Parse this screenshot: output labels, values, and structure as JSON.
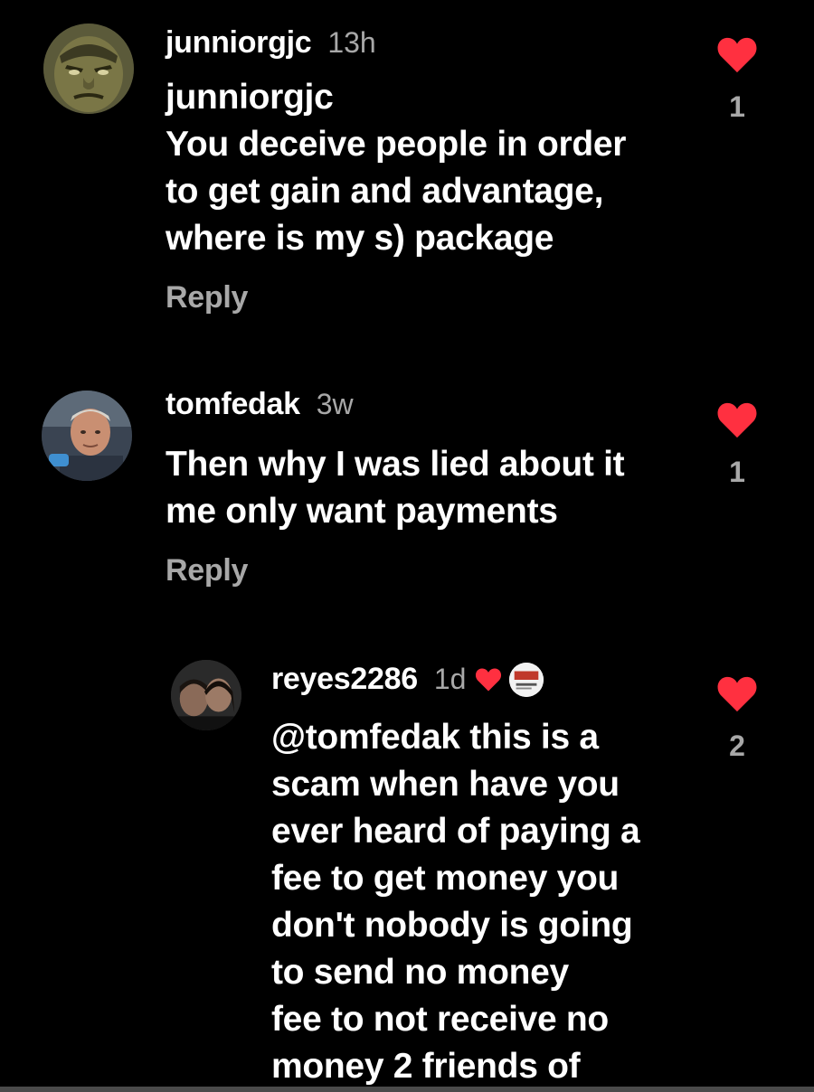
{
  "comments": [
    {
      "username": "junniorgjc",
      "time": "13h",
      "lines": [
        "junniorgjc",
        "You deceive people in order",
        "to get gain and advantage,",
        "where is my s) package"
      ],
      "reply_label": "Reply",
      "likes": "1",
      "avatar_icon": "hulk-face-avatar"
    },
    {
      "username": "tomfedak",
      "time": "3w",
      "lines": [
        "Then why I was lied about it",
        "me only want payments"
      ],
      "reply_label": "Reply",
      "likes": "1",
      "avatar_icon": "older-man-avatar"
    },
    {
      "username": "reyes2286",
      "time": "1d",
      "mention": "@tomfedak",
      "lines": [
        " this is a",
        "scam when have you",
        "ever heard of paying a",
        "fee to get money you",
        "don't nobody is going",
        "to send no money",
        "fee to not receive no",
        "money 2 friends of"
      ],
      "likes": "2",
      "avatar_icon": "two-people-avatar",
      "liked_by_author": true
    }
  ],
  "colors": {
    "background": "#000000",
    "text": "#ffffff",
    "muted": "#a8a8a8",
    "heart": "#ff3040"
  }
}
